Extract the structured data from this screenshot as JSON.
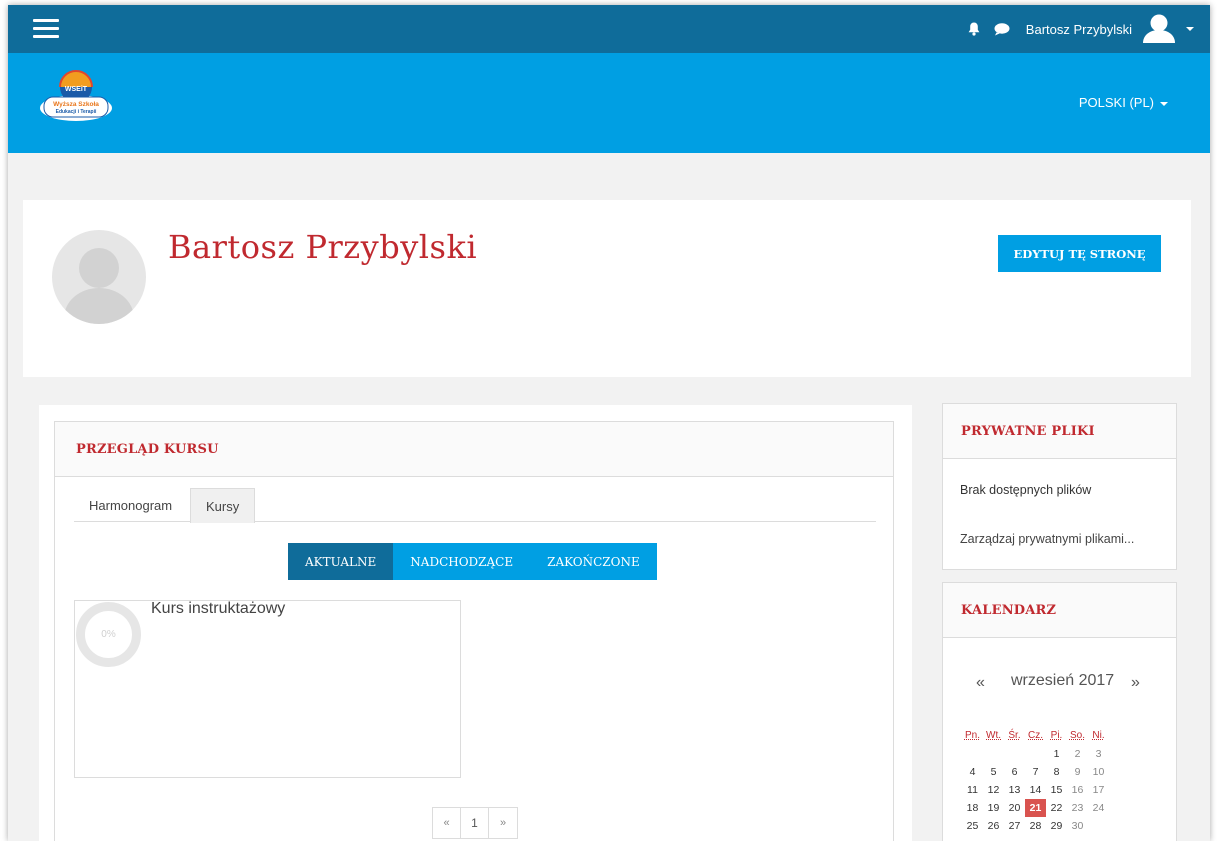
{
  "header": {
    "user_name": "Bartosz Przybylski",
    "language": "POLSKI (PL)",
    "logo_text_top": "WSEiT",
    "logo_text_line1": "Wyższa Szkoła",
    "logo_text_line2": "Edukacji i Terapii"
  },
  "profile": {
    "name": "Bartosz Przybylski",
    "edit_button": "EDYTUJ TĘ STRONĘ"
  },
  "course_overview": {
    "title": "PRZEGLĄD KURSU",
    "tabs": [
      "Harmonogram",
      "Kursy"
    ],
    "active_tab": "Kursy",
    "filters": [
      "AKTUALNE",
      "NADCHODZĄCE",
      "ZAKOŃCZONE"
    ],
    "active_filter": "AKTUALNE",
    "courses": [
      {
        "title": "Kurs instruktażowy",
        "progress": "0%"
      }
    ],
    "pager": {
      "prev": "«",
      "page": "1",
      "next": "»"
    }
  },
  "private_files": {
    "title": "PRYWATNE PLIKI",
    "empty_text": "Brak dostępnych plików",
    "manage_link": "Zarządzaj prywatnymi plikami..."
  },
  "calendar": {
    "title": "KALENDARZ",
    "prev": "«",
    "month": "wrzesień 2017",
    "next": "»",
    "day_headers": [
      "Pn.",
      "Wt.",
      "Śr.",
      "Cz.",
      "Pi.",
      "So.",
      "Ni."
    ],
    "weeks": [
      [
        "",
        "",
        "",
        "",
        "1",
        "2",
        "3"
      ],
      [
        "4",
        "5",
        "6",
        "7",
        "8",
        "9",
        "10"
      ],
      [
        "11",
        "12",
        "13",
        "14",
        "15",
        "16",
        "17"
      ],
      [
        "18",
        "19",
        "20",
        "21",
        "22",
        "23",
        "24"
      ],
      [
        "25",
        "26",
        "27",
        "28",
        "29",
        "30",
        ""
      ]
    ],
    "today": "21"
  },
  "colors": {
    "topbar": "#0f6c9a",
    "banner": "#009fe3",
    "accent_red": "#c0292f",
    "button_blue": "#009fe3",
    "active_dark_blue": "#0f6c9a",
    "today_red": "#d9534f"
  },
  "icons": [
    "menu-icon",
    "bell-icon",
    "chat-icon",
    "user-avatar-icon",
    "caret-down-icon"
  ]
}
